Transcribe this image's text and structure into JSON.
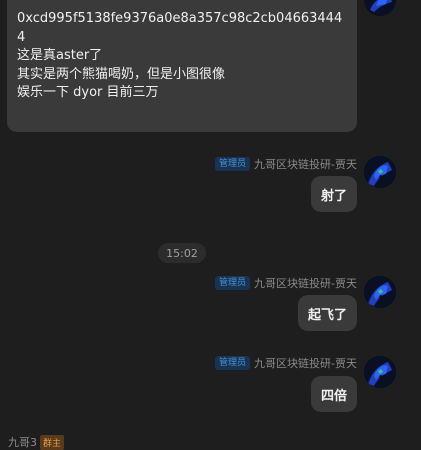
{
  "top_message": {
    "lines": [
      "0xcd995f5138fe9376a0e8a357c98c2cb04663444",
      "4",
      "这是真aster了",
      "其实是两个熊猫喝奶，但是小图很像",
      "娱乐一下  dyor  目前三万"
    ]
  },
  "messages": [
    {
      "role_badge": "管理员",
      "sender": "九哥区块链投研-贾天",
      "text": "射了"
    },
    {
      "role_badge": "管理员",
      "sender": "九哥区块链投研-贾天",
      "text": "起飞了"
    },
    {
      "role_badge": "管理员",
      "sender": "九哥区块链投研-贾天",
      "text": "四倍"
    }
  ],
  "timestamp": "15:02",
  "next_sender": {
    "name": "九哥3",
    "badge": "群主"
  },
  "colors": {
    "background": "#1e1e1e",
    "bubble": "#3a3a3a",
    "admin_badge_bg": "#183452",
    "admin_badge_text": "#4b8fd6",
    "owner_badge_bg": "#5a3a1a",
    "owner_badge_text": "#e39b4c"
  }
}
